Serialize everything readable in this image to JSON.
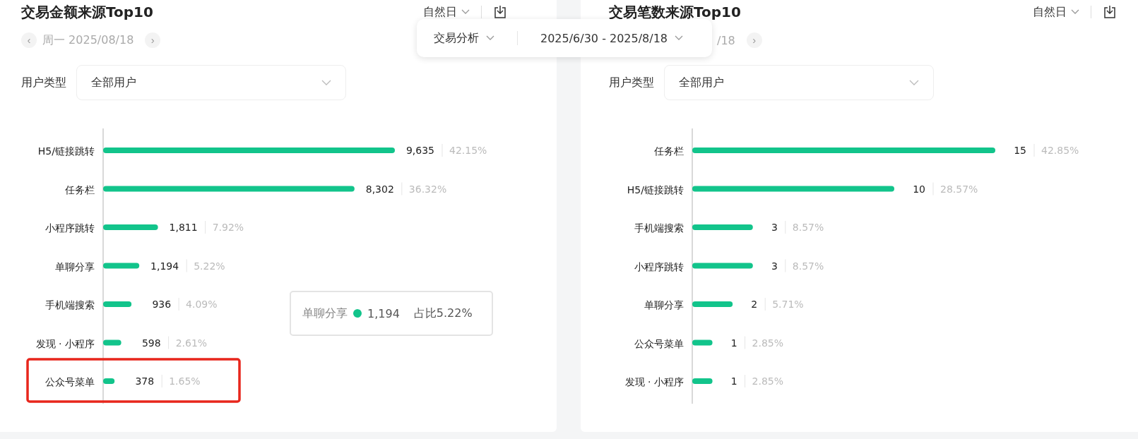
{
  "panels": [
    {
      "title": "交易金额来源Top10",
      "period": "自然日",
      "date": "周一 2025/08/18",
      "date_prev": "‹",
      "date_next": "›",
      "filter_label": "用户类型",
      "filter_value": "全部用户",
      "chart_data": {
        "type": "bar",
        "orientation": "horizontal",
        "categories": [
          "H5/链接跳转",
          "任务栏",
          "小程序跳转",
          "单聊分享",
          "手机端搜索",
          "发现 · 小程序",
          "公众号菜单"
        ],
        "values": [
          9635,
          8302,
          1811,
          1194,
          936,
          598,
          378
        ],
        "value_labels": [
          "9,635",
          "8,302",
          "1,811",
          "1,194",
          "936",
          "598",
          "378"
        ],
        "annotations": [
          "42.15%",
          "36.32%",
          "7.92%",
          "5.22%",
          "4.09%",
          "2.61%",
          "1.65%"
        ]
      },
      "highlighted": [
        false,
        false,
        false,
        false,
        false,
        false,
        true
      ],
      "tooltip": {
        "label": "单聊分享",
        "color": "#12c48b",
        "value": "1,194",
        "share": "占比5.22%"
      }
    },
    {
      "title": "交易笔数来源Top10",
      "period": "自然日",
      "date": "/18",
      "date_next": "›",
      "filter_label": "用户类型",
      "filter_value": "全部用户",
      "chart_data": {
        "type": "bar",
        "orientation": "horizontal",
        "categories": [
          "任务栏",
          "H5/链接跳转",
          "手机端搜索",
          "小程序跳转",
          "单聊分享",
          "公众号菜单",
          "发现 · 小程序"
        ],
        "values": [
          15,
          10,
          3,
          3,
          2,
          1,
          1
        ],
        "value_labels": [
          "15",
          "10",
          "3",
          "3",
          "2",
          "1",
          "1"
        ],
        "annotations": [
          "42.85%",
          "28.57%",
          "8.57%",
          "8.57%",
          "5.71%",
          "2.85%",
          "2.85%"
        ]
      },
      "highlighted": [
        false,
        false,
        false,
        false,
        false,
        false,
        false
      ]
    }
  ],
  "popover": {
    "mode": "交易分析",
    "range": "2025/6/30 - 2025/8/18"
  }
}
